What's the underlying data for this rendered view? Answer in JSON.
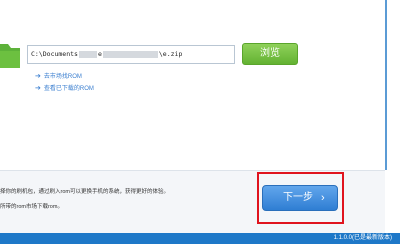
{
  "path_field": {
    "prefix": "C:\\Documents",
    "mid": "e",
    "suffix": "\\e.zip"
  },
  "browse_button": {
    "label": "浏览"
  },
  "links": [
    {
      "label": "去市场找ROM"
    },
    {
      "label": "查看已下载的ROM"
    }
  ],
  "info": {
    "line1": "择你的刷机包，通过刷入rom可以更换手机的系统，获得更好的体验。",
    "line2": "所带的rom市场下载rom。"
  },
  "next_button": {
    "label": "下一步",
    "chevron": "›"
  },
  "footer": {
    "version": "1.1.0.0(已是最新版本)"
  },
  "colors": {
    "accent_green": "#6cbf3a",
    "accent_blue": "#2f7ed3",
    "highlight_red": "#e0141e",
    "link_blue": "#3b7fd0",
    "footer_blue": "#1e78c8"
  }
}
